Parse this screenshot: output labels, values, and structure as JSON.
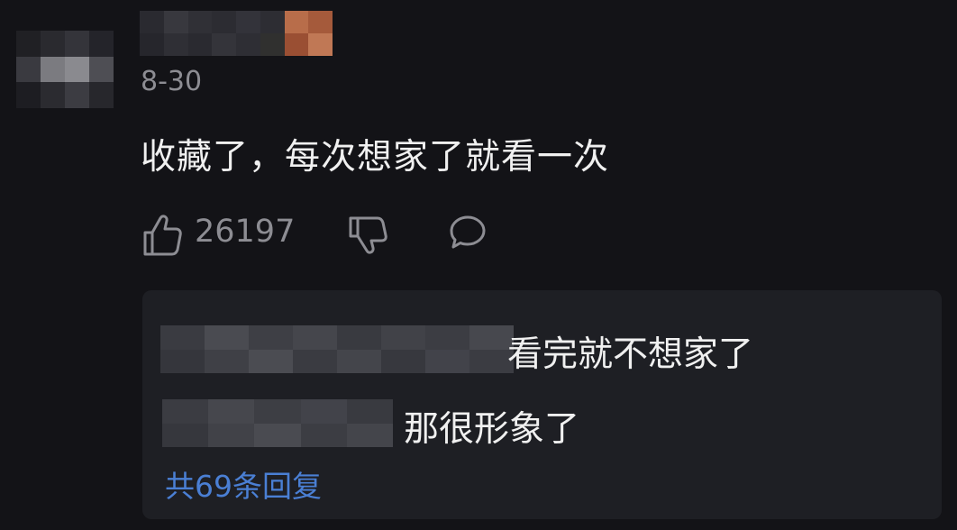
{
  "comment": {
    "avatar_icon": "pixelated-avatar",
    "username_icon": "pixelated-username",
    "date": "8-30",
    "text": "收藏了，每次想家了就看一次",
    "like_count": "26197"
  },
  "replies": {
    "items": [
      {
        "text": "看完就不想家了"
      },
      {
        "text": "那很形象了"
      }
    ],
    "more_label": "共69条回复"
  },
  "colors": {
    "background": "#131317",
    "reply_box": "#1e1f24",
    "link": "#4a7fd4",
    "muted": "#8d8d93"
  }
}
